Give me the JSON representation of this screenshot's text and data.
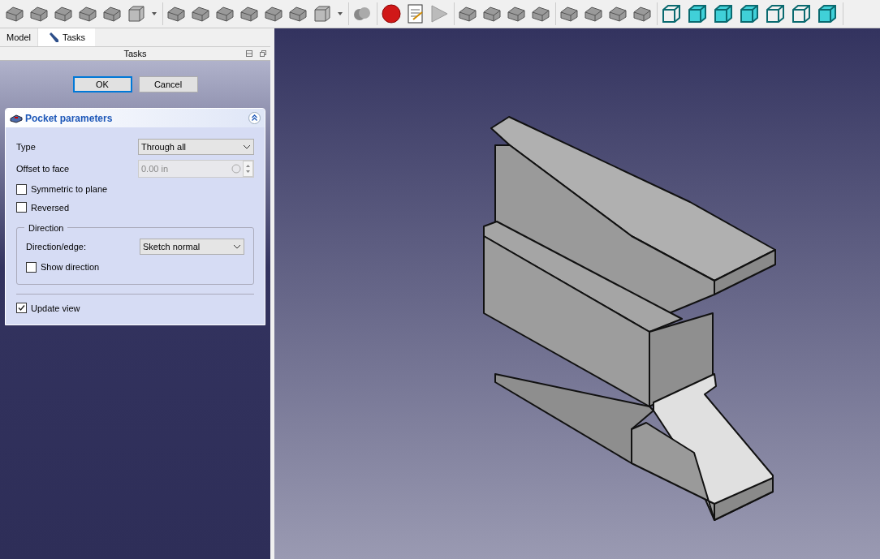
{
  "tabs": [
    {
      "label": "Model",
      "selected": false
    },
    {
      "label": "Tasks",
      "selected": true
    }
  ],
  "panel_title": "Tasks",
  "buttons": [
    {
      "label": "OK",
      "selected": true
    },
    {
      "label": "Cancel",
      "selected": false
    }
  ],
  "pocket": {
    "title": "Pocket parameters",
    "type": {
      "label": "Type",
      "value": "Through all"
    },
    "offset": {
      "label": "Offset to face",
      "value": "0.00 in",
      "disabled": true
    },
    "checks": [
      {
        "label": "Symmetric to plane",
        "checked": false
      },
      {
        "label": "Reversed",
        "checked": false
      }
    ],
    "direction": {
      "legend": "Direction",
      "edge_label": "Direction/edge:",
      "edge_value": "Sketch normal",
      "show": {
        "label": "Show direction",
        "checked": false
      }
    },
    "update": {
      "label": "Update view",
      "checked": true
    }
  }
}
